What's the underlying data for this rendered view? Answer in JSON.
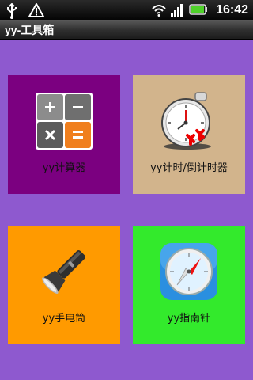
{
  "status_bar": {
    "time": "16:42",
    "icons": [
      "usb-icon",
      "warning-icon",
      "wifi-icon",
      "signal-icon",
      "battery-icon"
    ]
  },
  "app": {
    "title": "yy-工具箱"
  },
  "tiles": [
    {
      "label": "yy计算器",
      "icon": "calculator-icon",
      "color": "#7b0080"
    },
    {
      "label": "yy计时/倒计时器",
      "icon": "stopwatch-icon",
      "color": "#d2b48c"
    },
    {
      "label": "yy手电筒",
      "icon": "flashlight-icon",
      "color": "#ff9a00"
    },
    {
      "label": "yy指南针",
      "icon": "compass-icon",
      "color": "#33ea2c"
    }
  ],
  "colors": {
    "background": "#8e59cf"
  }
}
